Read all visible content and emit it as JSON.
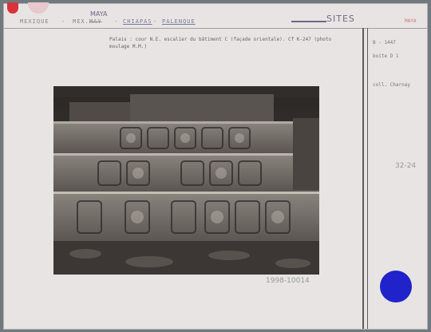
{
  "header": {
    "country": "MEXIQUE",
    "sub1": "MEX.",
    "sub1_struck": "MAY",
    "sub2": "CHIAPAS",
    "sub3": "PALENQUE",
    "dash": "-",
    "hand_maya": "MAYA",
    "hand_sites": "SITES",
    "right_tag": "MAYA"
  },
  "caption": "Palais : cour N.E. escalier du bâtiment C (façade orientale). Cf K-247 (photo moulage M.M.)",
  "side": {
    "ref": "B - 1447",
    "sub": "boite D 1",
    "collection": "coll. Charnay"
  },
  "pencil": {
    "ref": "32-24",
    "inventory": "1998-10014"
  },
  "colors": {
    "red_tab": "#d9323a",
    "blue_dot": "#1f23c9",
    "card": "#e7e4e3"
  }
}
